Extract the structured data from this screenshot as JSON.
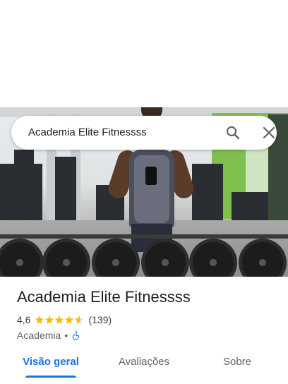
{
  "search": {
    "query": "Academia Elite Fitnessss"
  },
  "place": {
    "name": "Academia Elite Fitnessss",
    "rating": "4,6",
    "rating_stars": 4.6,
    "review_count": "(139)",
    "category": "Academia",
    "separator": "•"
  },
  "tabs": [
    {
      "label": "Visão geral",
      "active": true
    },
    {
      "label": "Avaliações",
      "active": false
    },
    {
      "label": "Sobre",
      "active": false
    }
  ],
  "colors": {
    "accent": "#1a73e8",
    "star": "#fbbc04",
    "text": "#202124",
    "muted": "#5f6368"
  },
  "icons": {
    "search": "search-icon",
    "close": "close-icon",
    "accessible": "wheelchair-accessible-icon"
  }
}
